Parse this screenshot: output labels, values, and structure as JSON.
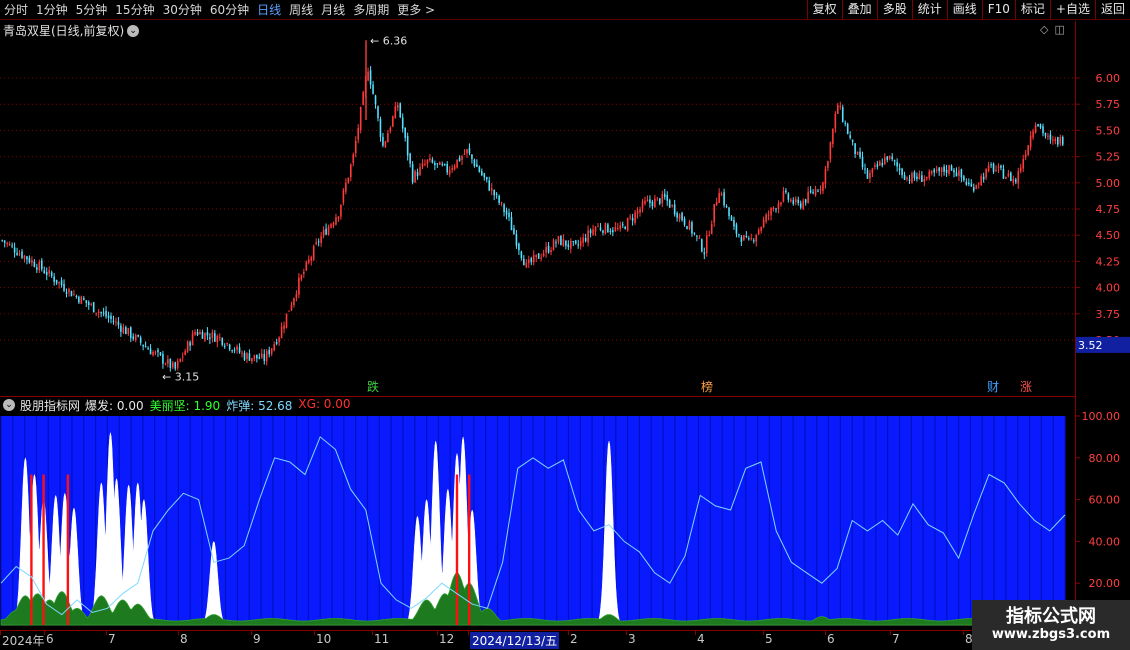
{
  "toolbar": {
    "periods": [
      "分时",
      "1分钟",
      "5分钟",
      "15分钟",
      "30分钟",
      "60分钟",
      "日线",
      "周线",
      "月线",
      "多周期",
      "更多 >"
    ],
    "active_period": "日线",
    "buttons": [
      "复权",
      "叠加",
      "多股",
      "统计",
      "画线",
      "F10",
      "标记",
      "+自选",
      "返回"
    ]
  },
  "stock": {
    "title": "青岛双星(日线,前复权)",
    "current_price_label": "3.52"
  },
  "annotations": {
    "high_label": "6.36",
    "low_label": "3.15",
    "markers": [
      {
        "text": "跌",
        "color": "#40d040"
      },
      {
        "text": "榜",
        "color": "#ffa040"
      },
      {
        "text": "财",
        "color": "#40a0ff"
      },
      {
        "text": "涨",
        "color": "#ff5050"
      }
    ]
  },
  "indicator": {
    "name": "股朋指标网",
    "items": [
      {
        "label": "爆发:",
        "value": "0.00",
        "color": "#e8e8e8"
      },
      {
        "label": "美丽坚:",
        "value": "1.90",
        "color": "#30ff30"
      },
      {
        "label": "炸弹:",
        "value": "52.68",
        "color": "#7fd8ff"
      },
      {
        "label": "XG:",
        "value": "0.00",
        "color": "#ff3030"
      }
    ]
  },
  "dates": [
    {
      "text": "2024年",
      "highlight": false
    },
    {
      "text": "6",
      "highlight": false
    },
    {
      "text": "7",
      "highlight": false
    },
    {
      "text": "8",
      "highlight": false
    },
    {
      "text": "9",
      "highlight": false
    },
    {
      "text": "10",
      "highlight": false
    },
    {
      "text": "11",
      "highlight": false
    },
    {
      "text": "12",
      "highlight": false
    },
    {
      "text": "2024/12/13/五",
      "highlight": true
    },
    {
      "text": "2",
      "highlight": false
    },
    {
      "text": "3",
      "highlight": false
    },
    {
      "text": "4",
      "highlight": false
    },
    {
      "text": "5",
      "highlight": false
    },
    {
      "text": "6",
      "highlight": false
    },
    {
      "text": "7",
      "highlight": false
    },
    {
      "text": "8",
      "highlight": false
    }
  ],
  "watermark": {
    "title": "指标公式网",
    "url": "www.zbgs3.com"
  },
  "colors": {
    "up": "#ff3b3b",
    "down": "#54e0ff",
    "grid": "#8a0000",
    "indicator_bg": "#0a1aff",
    "green_area": "#1e7a1e",
    "cyan_line": "#7fd8ff"
  },
  "chart_data": [
    {
      "type": "candlestick",
      "title": "青岛双星(日线,前复权)",
      "y_ticks": [
        "6.00",
        "5.75",
        "5.50",
        "5.25",
        "5.00",
        "4.75",
        "4.50",
        "4.25",
        "4.00",
        "3.75",
        "3.50"
      ],
      "ylim": [
        3.35,
        6.3
      ],
      "high": 6.36,
      "low": 3.15,
      "keypoints": [
        [
          0,
          4.45
        ],
        [
          15,
          4.2
        ],
        [
          28,
          3.95
        ],
        [
          45,
          3.68
        ],
        [
          60,
          3.4
        ],
        [
          70,
          3.22
        ],
        [
          78,
          3.58
        ],
        [
          88,
          3.52
        ],
        [
          98,
          3.35
        ],
        [
          106,
          3.32
        ],
        [
          112,
          3.55
        ],
        [
          120,
          4.05
        ],
        [
          128,
          4.45
        ],
        [
          136,
          4.72
        ],
        [
          142,
          5.25
        ],
        [
          148,
          6.1
        ],
        [
          154,
          5.35
        ],
        [
          160,
          5.75
        ],
        [
          166,
          5.05
        ],
        [
          172,
          5.2
        ],
        [
          180,
          5.12
        ],
        [
          188,
          5.3
        ],
        [
          196,
          5.0
        ],
        [
          204,
          4.7
        ],
        [
          212,
          4.2
        ],
        [
          218,
          4.32
        ],
        [
          225,
          4.45
        ],
        [
          232,
          4.38
        ],
        [
          240,
          4.58
        ],
        [
          250,
          4.55
        ],
        [
          260,
          4.8
        ],
        [
          268,
          4.85
        ],
        [
          278,
          4.58
        ],
        [
          284,
          4.35
        ],
        [
          290,
          4.95
        ],
        [
          296,
          4.55
        ],
        [
          302,
          4.42
        ],
        [
          310,
          4.7
        ],
        [
          316,
          4.88
        ],
        [
          322,
          4.78
        ],
        [
          332,
          5.0
        ],
        [
          338,
          5.75
        ],
        [
          344,
          5.35
        ],
        [
          350,
          5.05
        ],
        [
          358,
          5.25
        ],
        [
          366,
          5.05
        ],
        [
          374,
          5.05
        ],
        [
          384,
          5.15
        ],
        [
          392,
          4.95
        ],
        [
          400,
          5.15
        ],
        [
          410,
          5.02
        ],
        [
          418,
          5.6
        ],
        [
          424,
          5.38
        ],
        [
          430,
          5.42
        ]
      ]
    },
    {
      "type": "area",
      "title": "股朋指标网",
      "y_ticks": [
        "100.00",
        "80.00",
        "60.00",
        "40.00",
        "20.00"
      ],
      "ylim": [
        0,
        100
      ],
      "series": [
        {
          "name": "爆发",
          "peaks": [
            [
              8,
              80
            ],
            [
              11,
              72
            ],
            [
              14,
              60
            ],
            [
              18,
              62
            ],
            [
              21,
              63
            ],
            [
              24,
              56
            ],
            [
              33,
              68
            ],
            [
              36,
              92
            ],
            [
              38,
              70
            ],
            [
              42,
              67
            ],
            [
              45,
              68
            ],
            [
              47,
              60
            ],
            [
              70,
              40
            ],
            [
              137,
              52
            ],
            [
              140,
              60
            ],
            [
              143,
              88
            ],
            [
              147,
              65
            ],
            [
              150,
              82
            ],
            [
              152,
              90
            ],
            [
              155,
              55
            ],
            [
              200,
              88
            ]
          ]
        },
        {
          "name": "美丽坚",
          "peaks": [
            [
              5,
              7
            ],
            [
              8,
              14
            ],
            [
              12,
              15
            ],
            [
              16,
              12
            ],
            [
              20,
              16
            ],
            [
              25,
              8
            ],
            [
              33,
              14
            ],
            [
              40,
              12
            ],
            [
              45,
              10
            ],
            [
              70,
              5
            ],
            [
              140,
              12
            ],
            [
              146,
              15
            ],
            [
              150,
              25
            ],
            [
              154,
              20
            ],
            [
              160,
              8
            ],
            [
              200,
              5
            ],
            [
              270,
              4
            ],
            [
              330,
              5
            ]
          ]
        },
        {
          "name": "炸弹",
          "points": [
            [
              0,
              20
            ],
            [
              5,
              28
            ],
            [
              10,
              23
            ],
            [
              15,
              10
            ],
            [
              20,
              5
            ],
            [
              25,
              12
            ],
            [
              30,
              6
            ],
            [
              35,
              8
            ],
            [
              40,
              15
            ],
            [
              45,
              20
            ],
            [
              50,
              45
            ],
            [
              55,
              55
            ],
            [
              60,
              63
            ],
            [
              65,
              60
            ],
            [
              70,
              30
            ],
            [
              75,
              32
            ],
            [
              80,
              38
            ],
            [
              85,
              60
            ],
            [
              90,
              80
            ],
            [
              95,
              78
            ],
            [
              100,
              72
            ],
            [
              105,
              90
            ],
            [
              110,
              84
            ],
            [
              115,
              65
            ],
            [
              120,
              55
            ],
            [
              125,
              20
            ],
            [
              130,
              12
            ],
            [
              135,
              8
            ],
            [
              140,
              13
            ],
            [
              145,
              20
            ],
            [
              150,
              15
            ],
            [
              155,
              10
            ],
            [
              160,
              8
            ],
            [
              165,
              30
            ],
            [
              170,
              75
            ],
            [
              175,
              80
            ],
            [
              180,
              75
            ],
            [
              185,
              79
            ],
            [
              190,
              55
            ],
            [
              195,
              45
            ],
            [
              200,
              48
            ],
            [
              205,
              40
            ],
            [
              210,
              35
            ],
            [
              215,
              25
            ],
            [
              220,
              20
            ],
            [
              225,
              33
            ],
            [
              230,
              62
            ],
            [
              235,
              57
            ],
            [
              240,
              55
            ],
            [
              245,
              75
            ],
            [
              250,
              78
            ],
            [
              255,
              45
            ],
            [
              260,
              30
            ],
            [
              265,
              25
            ],
            [
              270,
              20
            ],
            [
              275,
              27
            ],
            [
              280,
              50
            ],
            [
              285,
              45
            ],
            [
              290,
              50
            ],
            [
              295,
              43
            ],
            [
              300,
              58
            ],
            [
              305,
              48
            ],
            [
              310,
              44
            ],
            [
              315,
              32
            ],
            [
              320,
              53
            ],
            [
              325,
              72
            ],
            [
              330,
              68
            ],
            [
              335,
              58
            ],
            [
              340,
              50
            ],
            [
              345,
              45
            ],
            [
              350,
              52.68
            ]
          ]
        },
        {
          "name": "XG",
          "bars": [
            10,
            14,
            22,
            150,
            154
          ]
        }
      ]
    }
  ]
}
